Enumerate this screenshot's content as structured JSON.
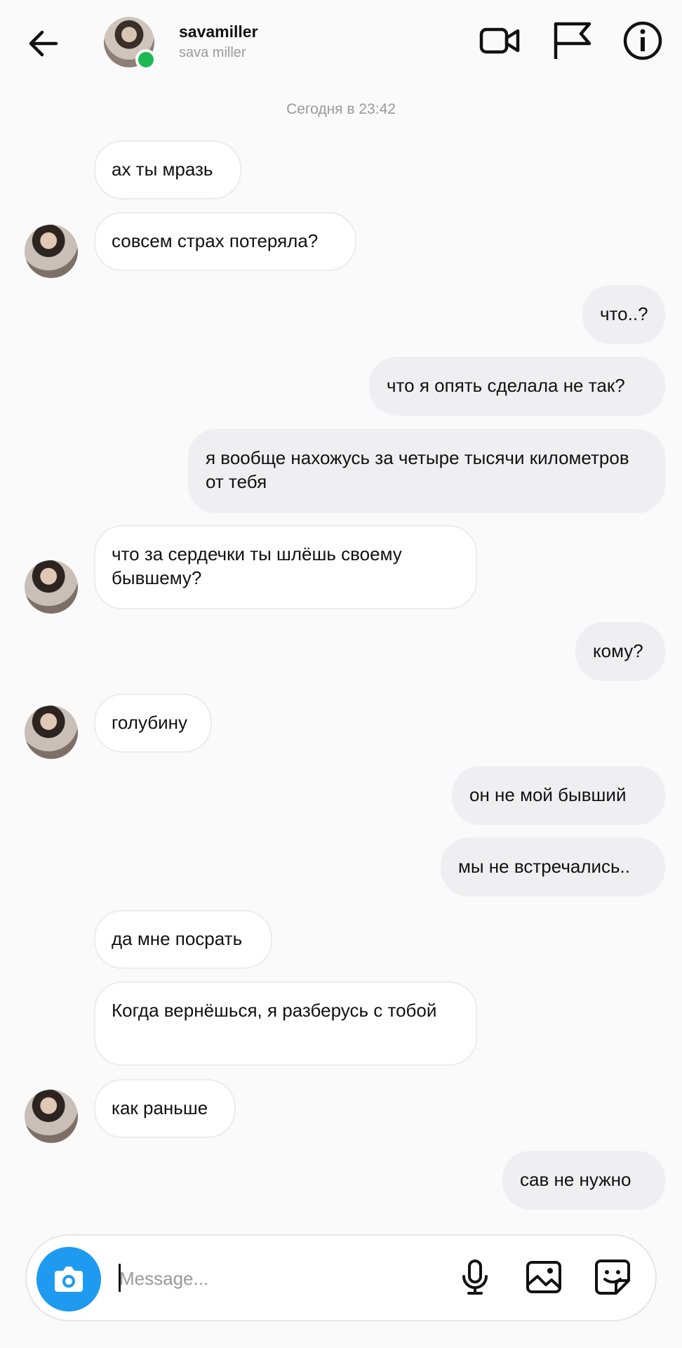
{
  "header": {
    "username": "savamiller",
    "fullname": "sava miller",
    "icons": [
      "back-arrow-icon",
      "video-camera-icon",
      "flag-icon",
      "info-icon"
    ]
  },
  "timestamp": "Сегодня в 23:42",
  "messages": [
    {
      "dir": "in",
      "text": "ах ты мразь"
    },
    {
      "dir": "in",
      "text": "совсем страх потеряла?"
    },
    {
      "dir": "out",
      "text": "что..?"
    },
    {
      "dir": "out",
      "text": "что я опять сделала не так?"
    },
    {
      "dir": "out",
      "text": "я вообще нахожусь за четыре тысячи километров от тебя"
    },
    {
      "dir": "in",
      "text": "что за сердечки ты шлёшь своему бывшему?"
    },
    {
      "dir": "out",
      "text": "кому?"
    },
    {
      "dir": "in",
      "text": "голубину"
    },
    {
      "dir": "out",
      "text": "он не мой бывший"
    },
    {
      "dir": "out",
      "text": "мы не встречались.."
    },
    {
      "dir": "in",
      "text": "да мне посрать"
    },
    {
      "dir": "in",
      "text": "Когда вернёшься, я разберусь с тобой"
    },
    {
      "dir": "in",
      "text": "как раньше"
    },
    {
      "dir": "out",
      "text": "сав не нужно"
    }
  ],
  "composer": {
    "placeholder": "Message...",
    "icons": [
      "camera-icon",
      "microphone-icon",
      "gallery-icon",
      "sticker-icon"
    ]
  },
  "colors": {
    "accent": "#1e9af0",
    "online": "#1db954",
    "outgoing_bubble": "#efeff1",
    "incoming_bubble": "#ffffff"
  }
}
